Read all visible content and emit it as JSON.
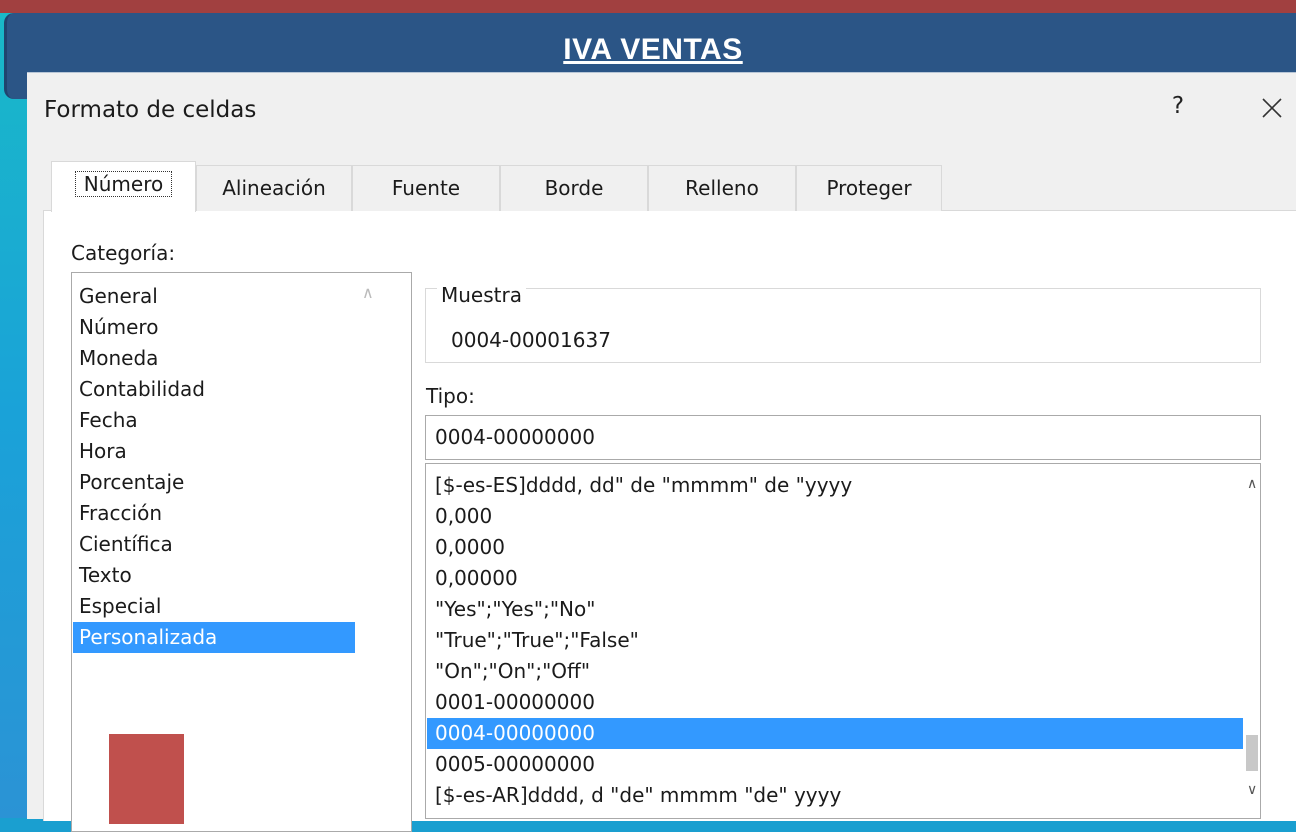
{
  "banner": {
    "title": "IVA VENTAS"
  },
  "dialog": {
    "title": "Formato de celdas",
    "help": "?",
    "tabs": [
      "Número",
      "Alineación",
      "Fuente",
      "Borde",
      "Relleno",
      "Proteger"
    ],
    "active_tab": "Número",
    "category_label": "Categoría:",
    "categories": [
      "General",
      "Número",
      "Moneda",
      "Contabilidad",
      "Fecha",
      "Hora",
      "Porcentaje",
      "Fracción",
      "Científica",
      "Texto",
      "Especial",
      "Personalizada"
    ],
    "selected_category": "Personalizada",
    "sample_label": "Muestra",
    "sample_value": "0004-00001637",
    "type_label": "Tipo:",
    "type_value": "0004-00000000",
    "formats": [
      "[$-es-ES]dddd, dd\" de \"mmmm\" de \"yyyy",
      "0,000",
      "0,0000",
      "0,00000",
      "\"Yes\";\"Yes\";\"No\"",
      "\"True\";\"True\";\"False\"",
      "\"On\";\"On\";\"Off\"",
      "0001-00000000",
      "0004-00000000",
      "0005-00000000",
      "[$-es-AR]dddd, d \"de\" mmmm \"de\" yyyy"
    ],
    "selected_format": "0004-00000000"
  },
  "colors": {
    "banner": "#2b5586",
    "selection": "#3399ff",
    "accent_red": "#c0504d"
  }
}
